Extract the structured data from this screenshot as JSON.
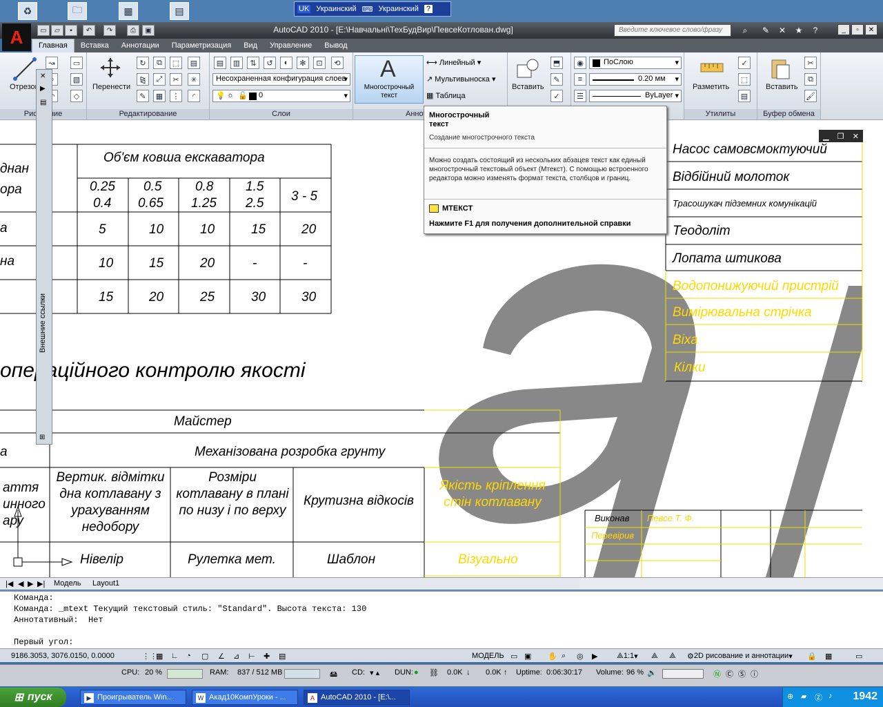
{
  "desktop": {
    "icons": [
      "recycle-icon",
      "folder-icon",
      "calendar-icon",
      "calculator-icon"
    ]
  },
  "langbar": {
    "lang1_code": "UK",
    "lang1": "Украинский",
    "lang2": "Украинский",
    "help": "?"
  },
  "app": {
    "title": "AutoCAD 2010 - [E:\\Навчальні\\ТехБудВир\\ПевсеКотлован.dwg]",
    "search_placeholder": "Введите ключевое слово/фразу"
  },
  "ribbon": {
    "tabs": [
      "Главная",
      "Вставка",
      "Аннотации",
      "Параметризация",
      "Вид",
      "Управление",
      "Вывод"
    ],
    "draw": {
      "label": "Рисование",
      "line_label": "Отрезок"
    },
    "modify": {
      "label": "Редактирование",
      "move_label": "Перенести"
    },
    "layers": {
      "label": "Слои",
      "layer_state": "Несохраненная конфигурация слоев",
      "current_layer": "0"
    },
    "annotation": {
      "label": "Аннотации",
      "mtext_label": "Многострочный текст",
      "linear": "Линейный",
      "multileader": "Мультивыноска",
      "table": "Таблица"
    },
    "block": {
      "insert_label": "Вставить"
    },
    "properties": {
      "color": "ПоСлою",
      "lineweight": "0.20 мм",
      "linetype": "ByLayer"
    },
    "utilities": {
      "label": "Утилиты",
      "measure_label": "Разметить"
    },
    "clipboard": {
      "label": "Буфер обмена",
      "paste_label": "Вставить"
    }
  },
  "tooltip": {
    "title": "Многострочный текст",
    "subtitle": "Создание многострочного текста",
    "description": "Можно создать состоящий из нескольких абзацев текст как единый многострочный текстовый объект (Мтекст). С помощью встроенного редактора можно изменять формат текста, столбцов и границ.",
    "command": "МТЕКСТ",
    "help": "Нажмите F1 для получения дополнительной справки"
  },
  "xref_palette": {
    "label": "Внешние ссылки"
  },
  "drawing": {
    "table1": {
      "header": "Об'єм ковша екскаватора",
      "left_partial": [
        "днан",
        "ора",
        "а",
        "на"
      ],
      "col_heads": [
        [
          "0.25",
          "0.4"
        ],
        [
          "0.5",
          "0.65"
        ],
        [
          "0.8",
          "1.25"
        ],
        [
          "1.5",
          "2.5"
        ],
        [
          "3 - 5"
        ]
      ],
      "rows": [
        [
          "5",
          "10",
          "10",
          "15",
          "20"
        ],
        [
          "10",
          "15",
          "20",
          "-",
          "-"
        ],
        [
          "15",
          "20",
          "25",
          "30",
          "30"
        ]
      ]
    },
    "section_title": "операційного контролю якості",
    "table2": {
      "row1": "Майстер",
      "row2_left": "а",
      "row2": "Механізована розробка грунту",
      "left_head": [
        "аття",
        "инного",
        "ару"
      ],
      "heads": [
        "Вертик. відмітки дна котлавану з урахуванням недобору",
        "Розміри котлавану в плані по низу і по верху",
        "Крутизна відкосів",
        "Якість кріплення стін котлавану"
      ],
      "tools": [
        "Нівелір",
        "Рулетка мет.",
        "Шаблон",
        "Візуально"
      ]
    },
    "equipment": [
      "Насос самовсмоктуючий",
      "Відбійний молоток",
      "Трасошукач підземних комунікацій",
      "Теодоліт",
      "Лопата штикова",
      "Водопонижуючий пристрій",
      "Вимірювальна стрічка",
      "Віха",
      "Кілки"
    ],
    "equipment_yellow_from": 5,
    "title_block": {
      "executed": "Виконав",
      "author": "Певсе Т. Ф.",
      "checked": "Перевірив"
    }
  },
  "layout_tabs": [
    "Модель",
    "Layout1"
  ],
  "command_line": {
    "lines": [
      "Команда:",
      "Команда: _mtext Текущий текстовый стиль: \"Standard\". Высота текста: 130",
      "Аннотативный:  Нет",
      "",
      "Первый угол:"
    ]
  },
  "statusbar": {
    "coords": "9186.3053, 3076.0150, 0.0000",
    "model": "МОДЕЛЬ",
    "scale": "1:1",
    "workspace": "2D рисование и аннотации"
  },
  "sysmon": {
    "cpu_label": "CPU:",
    "cpu": "20 %",
    "ram_label": "RAM:",
    "ram": "837 / 512 MB",
    "cd_label": "CD:",
    "dun_label": "DUN:",
    "down": "0.0K",
    "up": "0.0K",
    "uptime_label": "Uptime:",
    "uptime": "0:06:30:17",
    "volume_label": "Volume:",
    "volume": "96 %"
  },
  "taskbar": {
    "start": "пуск",
    "tasks": [
      "Проигрыватель Win...",
      "Акад10КомпУроки - ...",
      "AutoCAD 2010 - [E:\\..."
    ],
    "clock": "1942"
  }
}
